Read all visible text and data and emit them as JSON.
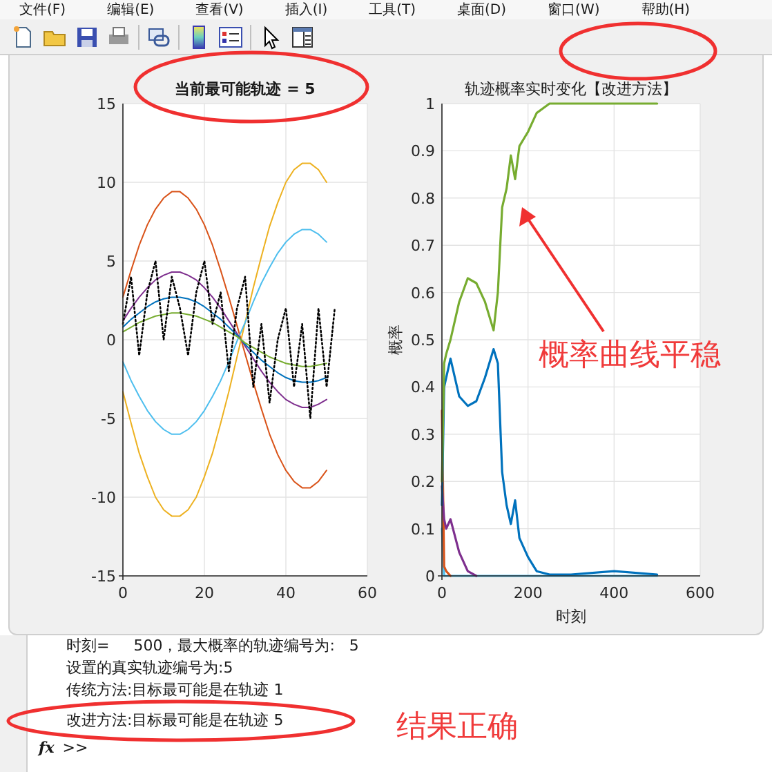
{
  "menu": [
    "文件(F)",
    "编辑(E)",
    "查看(V)",
    "插入(I)",
    "工具(T)",
    "桌面(D)",
    "窗口(W)",
    "帮助(H)"
  ],
  "charts": [
    {
      "chart_data": {
        "type": "line",
        "title": "当前最可能轨迹 = 5",
        "grid": true,
        "x": [
          0,
          2,
          4,
          6,
          8,
          10,
          12,
          14,
          16,
          18,
          20,
          22,
          24,
          26,
          28,
          30,
          32,
          34,
          36,
          38,
          40,
          42,
          44,
          46,
          48,
          50,
          52
        ],
        "xlim": [
          0,
          60
        ],
        "ylim": [
          -15,
          15
        ],
        "xticks": [
          0,
          20,
          40,
          60
        ],
        "yticks": [
          -15,
          -10,
          -5,
          0,
          5,
          10,
          15
        ],
        "series": [
          {
            "color": "#d95319",
            "values": [
              2.7,
              4.4,
              6.0,
              7.3,
              8.3,
              9.0,
              9.4,
              9.4,
              9.0,
              8.3,
              7.3,
              6.0,
              4.4,
              2.7,
              0.9,
              -0.9,
              -2.7,
              -4.4,
              -6.0,
              -7.3,
              -8.3,
              -9.0,
              -9.4,
              -9.4,
              -9.0,
              -8.3,
              null
            ]
          },
          {
            "color": "#edb120",
            "values": [
              -3.3,
              -5.3,
              -7.2,
              -8.7,
              -10.0,
              -10.8,
              -11.2,
              -11.2,
              -10.8,
              -10.0,
              -8.7,
              -7.2,
              -5.3,
              -3.3,
              -1.1,
              1.1,
              3.3,
              5.3,
              7.2,
              8.7,
              10.0,
              10.8,
              11.2,
              11.2,
              10.8,
              10.0,
              null
            ]
          },
          {
            "color": "#4dbeee",
            "values": [
              -1.4,
              -2.6,
              -3.6,
              -4.5,
              -5.2,
              -5.7,
              -6.0,
              -6.0,
              -5.7,
              -5.2,
              -4.5,
              -3.6,
              -2.6,
              -1.4,
              -0.1,
              1.1,
              2.4,
              3.6,
              4.6,
              5.5,
              6.2,
              6.7,
              7.0,
              7.0,
              6.7,
              6.2,
              null
            ]
          },
          {
            "color": "#7e2f8e",
            "values": [
              1.2,
              2.0,
              2.7,
              3.3,
              3.8,
              4.1,
              4.3,
              4.3,
              4.1,
              3.8,
              3.3,
              2.7,
              2.0,
              1.2,
              0.4,
              -0.4,
              -1.2,
              -2.0,
              -2.7,
              -3.3,
              -3.8,
              -4.1,
              -4.3,
              -4.3,
              -4.1,
              -3.8,
              null
            ]
          },
          {
            "color": "#0072bd",
            "values": [
              0.8,
              1.3,
              1.7,
              2.1,
              2.4,
              2.6,
              2.7,
              2.7,
              2.6,
              2.4,
              2.1,
              1.7,
              1.3,
              0.8,
              0.3,
              -0.3,
              -0.8,
              -1.3,
              -1.7,
              -2.1,
              -2.4,
              -2.6,
              -2.7,
              -2.7,
              -2.6,
              -2.4,
              null
            ]
          },
          {
            "color": "#77ac30",
            "values": [
              0.5,
              0.8,
              1.1,
              1.3,
              1.5,
              1.6,
              1.7,
              1.7,
              1.6,
              1.5,
              1.3,
              1.1,
              0.8,
              0.5,
              0.2,
              -0.2,
              -0.5,
              -0.8,
              -1.1,
              -1.3,
              -1.5,
              -1.6,
              -1.7,
              -1.7,
              -1.6,
              -1.5,
              null
            ]
          },
          {
            "color": "#000000",
            "line_style": "dotted",
            "values": [
              1,
              4,
              -1,
              3,
              5,
              0,
              4,
              2,
              -1,
              3,
              5,
              1,
              3,
              -2,
              2,
              4,
              -3,
              1,
              -4,
              0,
              2,
              -3,
              1,
              -5,
              2,
              -3,
              2
            ]
          }
        ]
      }
    },
    {
      "chart_data": {
        "type": "line",
        "title": "轨迹概率实时变化【改进方法】",
        "xlabel": "时刻",
        "ylabel": "概率",
        "grid": true,
        "x": [
          0,
          5,
          10,
          20,
          40,
          60,
          80,
          100,
          120,
          130,
          140,
          150,
          160,
          170,
          180,
          200,
          220,
          250,
          300,
          400,
          500
        ],
        "xlim": [
          0,
          600
        ],
        "ylim": [
          0,
          1
        ],
        "xticks": [
          0,
          200,
          400,
          600
        ],
        "yticks": [
          0,
          0.1,
          0.2,
          0.3,
          0.4,
          0.5,
          0.6,
          0.7,
          0.8,
          0.9,
          1
        ],
        "series": [
          {
            "color": "#77ac30",
            "values": [
              0.2,
              0.45,
              0.47,
              0.5,
              0.58,
              0.63,
              0.62,
              0.58,
              0.52,
              0.6,
              0.78,
              0.82,
              0.89,
              0.84,
              0.91,
              0.94,
              0.98,
              1,
              1,
              1,
              1
            ]
          },
          {
            "color": "#0072bd",
            "values": [
              0.15,
              0.4,
              0.42,
              0.46,
              0.38,
              0.36,
              0.37,
              0.42,
              0.48,
              0.45,
              0.22,
              0.15,
              0.11,
              0.16,
              0.08,
              0.04,
              0.01,
              0.003,
              0.003,
              0.01,
              0.003
            ]
          },
          {
            "color": "#7e2f8e",
            "values": [
              0.19,
              0.12,
              0.1,
              0.12,
              0.05,
              0.01,
              0,
              null,
              null,
              null,
              null,
              null,
              null,
              null,
              null,
              null,
              null,
              null,
              null,
              null,
              null
            ]
          },
          {
            "color": "#d95319",
            "values": [
              0.35,
              0.02,
              0.01,
              0,
              null,
              null,
              null,
              null,
              null,
              null,
              null,
              null,
              null,
              null,
              null,
              null,
              null,
              null,
              null,
              null,
              null
            ]
          },
          {
            "color": "#4dbeee",
            "values": [
              0.1,
              0,
              0,
              0,
              0,
              0,
              0,
              0,
              0,
              0,
              0,
              0,
              0,
              0,
              0,
              0,
              0,
              0,
              0,
              0,
              0
            ]
          }
        ]
      }
    }
  ],
  "annotations": [
    {
      "text": "概率曲线平稳"
    },
    {
      "text": "结果正确"
    }
  ],
  "console": {
    "lines": [
      "时刻=     500，最大概率的轨迹编号为:   5",
      "设置的真实轨迹编号为:5",
      "传统方法:目标最可能是在轨迹 1",
      "改进方法:目标最可能是在轨迹 5"
    ],
    "function_label": "fx",
    "prompt": ">>"
  }
}
